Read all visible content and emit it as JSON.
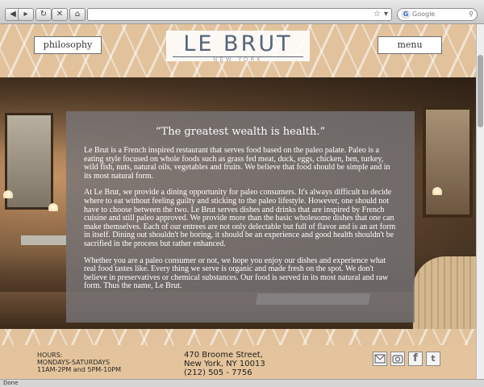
{
  "browser": {
    "url": "",
    "search_placeholder": "Google",
    "status": "Done"
  },
  "header": {
    "philosophy_label": "philosophy",
    "menu_label": "menu",
    "logo": "LE BRUT",
    "sublogo": "NEW YORK"
  },
  "content": {
    "quote": "“The greatest wealth is health.”",
    "paragraphs": [
      "Le Brut is a French inspired restaurant that serves food based on the paleo palate. Paleo is a eating style focused on whole foods such as grass fed meat, duck, eggs, chicken, hen, turkey, wild fish, nuts, natural oils, vegetables and fruits. We believe that food should be simple and in its most natural form.",
      "At Le Brut, we provide a dining opportunity for paleo consumers. It's always difficult to decide where to eat without feeling guilty and sticking to the paleo lifestyle. However, one should not have to choose between the two. Le Brut serves dishes and drinks that are inspired by French cuisine and still paleo approved. We provide more than the basic wholesome dishes that one can make themselves. Each of our entrees are not only delectable but full of flavor and is an art form in itself. Dining out shouldn't be boring, it should be an experience and good health shouldn't be sacrified in the process but rather enhanced.",
      "Whether you are a paleo consumer or not, we hope you enjoy our dishes and experience what real food tastes like. Every thing we serve is organic and made fresh on the spot. We don't believe in preservatives or chemical substances. Our food is served in its most natural and raw form. Thus the name, Le Brut."
    ]
  },
  "footer": {
    "hours_title": "HOURS:",
    "hours_days": "MONDAYS-SATURDAYS",
    "hours_times": "11AM-2PM and 5PM-10PM",
    "address_line1": "470 Broome Street,",
    "address_line2": "New York, NY 10013",
    "phone": "(212) 505 - 7756",
    "social_icons": [
      "mail-icon",
      "camera-icon",
      "facebook-icon",
      "twitter-icon"
    ]
  }
}
